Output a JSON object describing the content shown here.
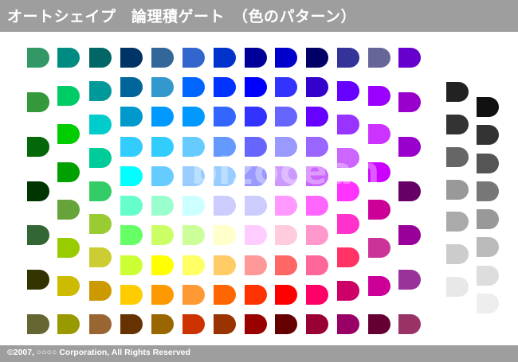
{
  "header": {
    "title": "オートシェイプ　論理積ゲート　（色のパターン）"
  },
  "footer": {
    "copyright": "©2007, ○○○○ Corporation, All Rights Reserved"
  },
  "watermark": {
    "text": "bizocean"
  },
  "palette": {
    "columns": [
      [
        "#329966",
        "#33993a",
        "#03680a",
        "#003400",
        "#336635",
        "#333300",
        "#666633"
      ],
      [
        "#008b82",
        "#00cc66",
        "#00cc00",
        "#00a000",
        "#66a33a",
        "#99cc00",
        "#ccbb00",
        "#999900"
      ],
      [
        "#006666",
        "#009999",
        "#00cccc",
        "#00cc99",
        "#33cc66",
        "#99cc33",
        "#cccc33",
        "#cc9900",
        "#996633"
      ],
      [
        "#003366",
        "#006699",
        "#0099cc",
        "#33ccff",
        "#00ffff",
        "#66ffcc",
        "#66ff66",
        "#ccff33",
        "#ffcc00",
        "#663300"
      ],
      [
        "#336699",
        "#3399cc",
        "#0099ff",
        "#33ccff",
        "#66ccff",
        "#99ffcc",
        "#ccff66",
        "#ffff00",
        "#ff9900",
        "#996600"
      ],
      [
        "#3366cc",
        "#0066ff",
        "#0099ff",
        "#66ccff",
        "#99ccff",
        "#ccffff",
        "#ccff99",
        "#ffff66",
        "#ff9933",
        "#cc3300"
      ],
      [
        "#0033cc",
        "#0033ff",
        "#3366ff",
        "#6699ff",
        "#99ccff",
        "#ccccff",
        "#ffffcc",
        "#ffcc66",
        "#ff6600",
        "#993300"
      ],
      [
        "#000099",
        "#0000ff",
        "#3333ff",
        "#6666ff",
        "#9999ff",
        "#ccccff",
        "#ffccff",
        "#ff9999",
        "#ff3300",
        "#990000"
      ],
      [
        "#0000cc",
        "#3333ff",
        "#6666ff",
        "#9999ff",
        "#cc99ff",
        "#ff99ff",
        "#ffccdd",
        "#ff6666",
        "#ff0000",
        "#660000"
      ],
      [
        "#000066",
        "#3300cc",
        "#6600ff",
        "#9966ff",
        "#cc66ff",
        "#ff66ff",
        "#ff99cc",
        "#ff6699",
        "#ff0066",
        "#990033"
      ],
      [
        "#333399",
        "#6600ff",
        "#9933ff",
        "#cc66ff",
        "#ff33ff",
        "#ff33cc",
        "#ff3366",
        "#cc0066",
        "#990066"
      ],
      [
        "#666699",
        "#9900ff",
        "#cc33ff",
        "#cc00ff",
        "#cc0099",
        "#cc3399",
        "#cc0099",
        "#660033"
      ],
      [
        "#6600cc",
        "#9900cc",
        "#9900cc",
        "#660066",
        "#990099",
        "#993399",
        "#993366"
      ]
    ],
    "grays_a": [
      "#222222",
      "#333333",
      "#666666",
      "#999999",
      "#aaaaaa",
      "#cccccc",
      "#e8e8e8"
    ],
    "grays_b": [
      "#111111",
      "#333333",
      "#555555",
      "#777777",
      "#999999",
      "#bbbbbb",
      "#dddddd",
      "#eeeeee"
    ]
  }
}
